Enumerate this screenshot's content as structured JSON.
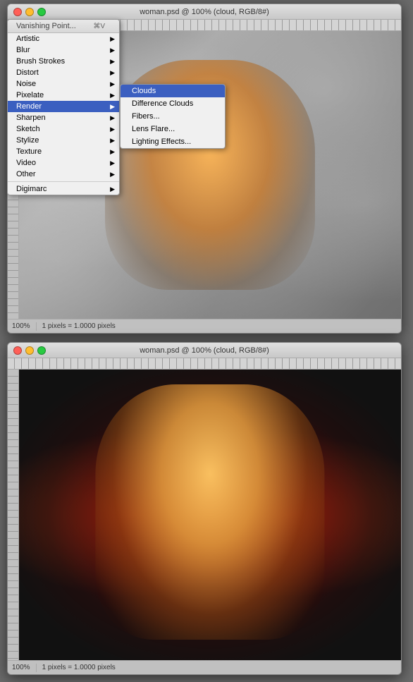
{
  "windows": {
    "top": {
      "title": "woman.psd @ 100% (cloud, RGB/8#)",
      "zoom": "100%",
      "pixels": "1 pixels = 1.0000 pixels"
    },
    "bottom": {
      "title": "woman.psd @ 100% (cloud, RGB/8#)",
      "zoom": "100%",
      "pixels": "1 pixels = 1.0000 pixels"
    }
  },
  "menu": {
    "vanishing_point": "Vanishing Point...",
    "vanishing_shortcut": "⌘V",
    "items": [
      {
        "label": "Artistic",
        "has_arrow": true
      },
      {
        "label": "Blur",
        "has_arrow": true
      },
      {
        "label": "Brush Strokes",
        "has_arrow": true
      },
      {
        "label": "Distort",
        "has_arrow": true
      },
      {
        "label": "Noise",
        "has_arrow": true
      },
      {
        "label": "Pixelate",
        "has_arrow": true
      },
      {
        "label": "Render",
        "has_arrow": true,
        "highlighted": true
      },
      {
        "label": "Sharpen",
        "has_arrow": true
      },
      {
        "label": "Sketch",
        "has_arrow": true
      },
      {
        "label": "Stylize",
        "has_arrow": true
      },
      {
        "label": "Texture",
        "has_arrow": true
      },
      {
        "label": "Video",
        "has_arrow": true
      },
      {
        "label": "Other",
        "has_arrow": true
      },
      {
        "separator": true
      },
      {
        "label": "Digimarc",
        "has_arrow": true
      }
    ],
    "submenu": [
      {
        "label": "Clouds",
        "active": true
      },
      {
        "label": "Difference Clouds"
      },
      {
        "label": "Fibers..."
      },
      {
        "label": "Lens Flare..."
      },
      {
        "label": "Lighting Effects..."
      }
    ]
  }
}
